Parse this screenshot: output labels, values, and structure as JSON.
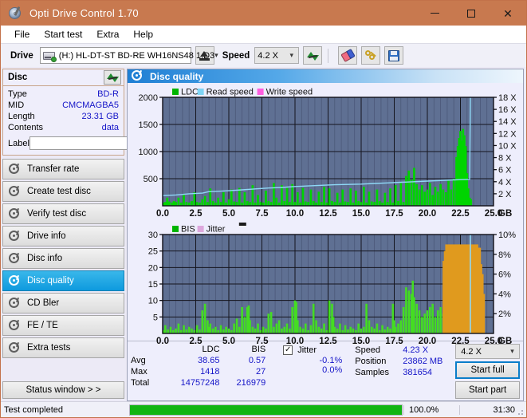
{
  "window": {
    "title": "Opti Drive Control 1.70",
    "title_icon": "disc-pen-icon",
    "minimize": "—",
    "maximize": "□",
    "close": "✕",
    "accent": "#c8794f"
  },
  "menu": {
    "items": [
      "File",
      "Start test",
      "Extra",
      "Help"
    ]
  },
  "toolbar": {
    "drive_label": "Drive",
    "drive_value": "(H:)  HL-DT-ST BD-RE  WH16NS48 1.D3",
    "eject_icon": "eject-icon",
    "speed_label": "Speed",
    "speed_value": "4.2 X",
    "refresh_icon": "refresh-icon",
    "erase_icon": "eraser-icon",
    "keys_icon": "keys-icon",
    "save_icon": "save-icon",
    "dropdown_arrow": "⌄"
  },
  "disc": {
    "header": "Disc",
    "refresh_icon": "refresh-icon",
    "rows": [
      {
        "key": "Type",
        "value": "BD-R"
      },
      {
        "key": "MID",
        "value": "CMCMAGBA5"
      },
      {
        "key": "Length",
        "value": "23.31 GB"
      },
      {
        "key": "Contents",
        "value": "data"
      }
    ],
    "label_key": "Label",
    "label_value": "",
    "label_placeholder": "",
    "cd_icon": "cd-icon"
  },
  "sidebar": {
    "items": [
      {
        "label": "Transfer rate",
        "active": false
      },
      {
        "label": "Create test disc",
        "active": false
      },
      {
        "label": "Verify test disc",
        "active": false
      },
      {
        "label": "Drive info",
        "active": false
      },
      {
        "label": "Disc info",
        "active": false
      },
      {
        "label": "Disc quality",
        "active": true
      },
      {
        "label": "CD Bler",
        "active": false
      },
      {
        "label": "FE / TE",
        "active": false
      },
      {
        "label": "Extra tests",
        "active": false
      }
    ],
    "status_button": "Status window > >"
  },
  "panel": {
    "title": "Disc quality",
    "icon": "disc-quality-icon"
  },
  "stats": {
    "col_headers": [
      "LDC",
      "BIS"
    ],
    "row_labels": [
      "Avg",
      "Max",
      "Total"
    ],
    "ldc": [
      "38.65",
      "1418",
      "14757248"
    ],
    "bis": [
      "0.57",
      "27",
      "216979"
    ],
    "jitter_label": "Jitter",
    "jitter_checked": "✓",
    "jitter_values": [
      "-0.1%",
      "0.0%"
    ],
    "speed_key": "Speed",
    "speed_value": "4.23 X",
    "position_key": "Position",
    "position_value": "23862 MB",
    "samples_key": "Samples",
    "samples_value": "381654",
    "speed_select": "4.2 X",
    "start_full": "Start full",
    "start_part": "Start part"
  },
  "statusbar": {
    "text": "Test completed",
    "progress": 100,
    "percent": "100.0%",
    "time": "31:30",
    "progress_color": "#12b512"
  },
  "chart_data": [
    {
      "id": "ldc-chart",
      "type": "area",
      "title": "Disc quality",
      "xlabel": "GB",
      "ylabel": "LDC",
      "xlim": [
        0,
        25
      ],
      "ylim": [
        0,
        2000
      ],
      "y2lim": [
        0,
        18
      ],
      "y2label": "X",
      "grid": true,
      "legend_position": "top-left",
      "legend": [
        {
          "name": "LDC",
          "color": "#00b400"
        },
        {
          "name": "Read speed",
          "color": "#7fd4f5"
        },
        {
          "name": "Write speed",
          "color": "#ff5ee0"
        }
      ],
      "xticks": [
        0.0,
        2.5,
        5.0,
        7.5,
        10.0,
        12.5,
        15.0,
        17.5,
        20.0,
        22.5,
        25.0
      ],
      "xticklabels": [
        "0.0",
        "2.5",
        "5.0",
        "7.5",
        "10.0",
        "12.5",
        "15.0",
        "17.5",
        "20.0",
        "22.5",
        "25.0"
      ],
      "yticks": [
        500,
        1000,
        1500,
        2000
      ],
      "yticklabels": [
        "500",
        "1000",
        "1500",
        "2000"
      ],
      "y2ticks": [
        2,
        4,
        6,
        8,
        10,
        12,
        14,
        16,
        18
      ],
      "y2ticklabels": [
        "2 X",
        "4 X",
        "6 X",
        "8 X",
        "10 X",
        "12 X",
        "14 X",
        "16 X",
        "18 X"
      ],
      "series": [
        {
          "name": "LDC",
          "color": "#00d400",
          "axis": "left",
          "x": [
            0.05,
            0.2,
            0.35,
            0.5,
            0.7,
            0.85,
            1.0,
            1.2,
            1.4,
            1.6,
            1.8,
            2.0,
            2.2,
            2.4,
            2.6,
            2.8,
            3.0,
            3.2,
            3.4,
            3.6,
            3.8,
            4.0,
            4.2,
            4.4,
            4.6,
            4.8,
            5.0,
            5.2,
            5.4,
            5.6,
            5.8,
            6.0,
            6.2,
            6.4,
            6.6,
            6.8,
            7.0,
            7.2,
            7.4,
            7.6,
            7.8,
            8.0,
            8.2,
            8.4,
            8.6,
            8.8,
            9.0,
            9.2,
            9.4,
            9.6,
            9.8,
            10.0,
            10.2,
            10.4,
            10.6,
            10.8,
            11.0,
            11.2,
            11.4,
            11.6,
            11.8,
            12.0,
            12.2,
            12.4,
            12.6,
            12.8,
            13.0,
            13.2,
            13.4,
            13.6,
            13.8,
            14.0,
            14.2,
            14.4,
            14.6,
            14.8,
            15.0,
            15.2,
            15.4,
            15.6,
            15.8,
            16.0,
            16.2,
            16.4,
            16.6,
            16.8,
            17.0,
            17.2,
            17.4,
            17.6,
            17.8,
            18.0,
            18.2,
            18.4,
            18.6,
            18.8,
            19.0,
            19.2,
            19.4,
            19.6,
            19.8,
            20.0,
            20.2,
            20.4,
            20.6,
            20.8,
            21.0,
            21.2,
            21.4,
            21.6,
            21.8,
            22.0,
            22.2,
            22.3,
            22.4,
            22.5,
            22.6,
            22.7,
            22.8,
            22.9,
            23.0,
            23.1,
            23.2,
            23.3
          ],
          "y": [
            60,
            70,
            150,
            80,
            60,
            90,
            70,
            150,
            60,
            200,
            70,
            60,
            90,
            250,
            70,
            60,
            120,
            180,
            70,
            320,
            90,
            60,
            150,
            70,
            250,
            60,
            120,
            300,
            80,
            70,
            330,
            60,
            250,
            90,
            70,
            380,
            60,
            200,
            70,
            60,
            280,
            90,
            70,
            420,
            150,
            60,
            380,
            90,
            330,
            70,
            400,
            70,
            250,
            60,
            330,
            80,
            70,
            300,
            90,
            60,
            260,
            70,
            350,
            60,
            320,
            90,
            70,
            240,
            60,
            300,
            80,
            70,
            320,
            60,
            280,
            90,
            70,
            350,
            60,
            260,
            80,
            70,
            300,
            90,
            60,
            240,
            70,
            320,
            60,
            380,
            90,
            420,
            70,
            550,
            650,
            480,
            700,
            400,
            300,
            380,
            260,
            300,
            420,
            200,
            350,
            260,
            400,
            300,
            250,
            480,
            300,
            500,
            900,
            1100,
            1250,
            1380,
            1200,
            1418,
            1300,
            1100,
            600,
            320,
            150,
            120
          ]
        },
        {
          "name": "Read speed",
          "color": "#8fd9f7",
          "axis": "right",
          "x": [
            0.0,
            1.0,
            2.0,
            3.0,
            3.5,
            4.0,
            5.0,
            6.0,
            7.0,
            8.0,
            9.0,
            10.0,
            11.0,
            12.0,
            13.0,
            14.0,
            15.0,
            16.0,
            17.0,
            18.0,
            19.0,
            20.0,
            21.0,
            22.0,
            22.8,
            23.2,
            23.25,
            23.3
          ],
          "y": [
            1.7,
            1.8,
            2.0,
            2.1,
            2.35,
            2.4,
            2.5,
            2.65,
            2.8,
            2.95,
            3.05,
            3.2,
            3.3,
            3.4,
            3.5,
            3.55,
            3.6,
            3.7,
            3.8,
            3.9,
            4.0,
            4.1,
            4.2,
            4.3,
            4.35,
            4.4,
            18.0,
            18.0
          ]
        }
      ]
    },
    {
      "id": "bis-chart",
      "type": "area",
      "xlabel": "GB",
      "ylabel": "BIS",
      "xlim": [
        0,
        25
      ],
      "ylim": [
        0,
        30
      ],
      "y2lim": [
        0,
        10
      ],
      "y2label": "%",
      "grid": true,
      "legend_position": "top-left",
      "legend": [
        {
          "name": "BIS",
          "color": "#00b400"
        },
        {
          "name": "Jitter",
          "color": "#dda8dd"
        }
      ],
      "xticks": [
        0.0,
        2.5,
        5.0,
        7.5,
        10.0,
        12.5,
        15.0,
        17.5,
        20.0,
        22.5,
        25.0
      ],
      "xticklabels": [
        "0.0",
        "2.5",
        "5.0",
        "7.5",
        "10.0",
        "12.5",
        "15.0",
        "17.5",
        "20.0",
        "22.5",
        "25.0"
      ],
      "yticks": [
        5,
        10,
        15,
        20,
        25,
        30
      ],
      "yticklabels": [
        "5",
        "10",
        "15",
        "20",
        "25",
        "30"
      ],
      "y2ticks": [
        2,
        4,
        6,
        8,
        10
      ],
      "y2ticklabels": [
        "2%",
        "4%",
        "6%",
        "8%",
        "10%"
      ],
      "series": [
        {
          "name": "BIS",
          "color": "#44dd22",
          "axis": "left",
          "x": [
            0.05,
            0.2,
            0.4,
            0.6,
            0.8,
            1.0,
            1.2,
            1.4,
            1.6,
            1.8,
            2.0,
            2.2,
            2.4,
            2.6,
            2.8,
            3.0,
            3.2,
            3.4,
            3.5,
            3.6,
            3.8,
            4.0,
            4.2,
            4.4,
            4.6,
            4.8,
            5.0,
            5.2,
            5.4,
            5.6,
            5.8,
            6.0,
            6.2,
            6.4,
            6.5,
            6.6,
            6.8,
            7.0,
            7.2,
            7.4,
            7.6,
            7.8,
            8.0,
            8.2,
            8.4,
            8.6,
            8.8,
            9.0,
            9.2,
            9.4,
            9.6,
            9.8,
            10.0,
            10.1,
            10.2,
            10.4,
            10.6,
            10.8,
            11.0,
            11.2,
            11.4,
            11.6,
            11.8,
            12.0,
            12.2,
            12.4,
            12.6,
            12.8,
            12.9,
            13.0,
            13.2,
            13.4,
            13.6,
            13.8,
            14.0,
            14.2,
            14.4,
            14.6,
            14.8,
            15.0,
            15.2,
            15.4,
            15.6,
            15.8,
            16.0,
            16.2,
            16.4,
            16.6,
            16.8,
            17.0,
            17.2,
            17.4,
            17.5,
            17.6,
            17.8,
            18.0,
            18.2,
            18.4,
            18.6,
            18.8,
            18.9,
            19.0,
            19.2,
            19.4,
            19.6,
            19.8,
            20.0,
            20.2,
            20.4,
            20.6,
            20.8,
            21.0,
            21.2,
            21.4,
            21.6,
            21.8,
            22.0,
            22.2,
            22.4,
            22.5,
            22.6,
            22.7,
            22.8,
            22.9,
            23.0,
            23.1,
            23.2,
            23.3
          ],
          "y": [
            1,
            2.5,
            1.2,
            2,
            1,
            1.5,
            3,
            1,
            2.5,
            1.2,
            2,
            1.5,
            1,
            2.5,
            1.2,
            7,
            9,
            4,
            2,
            3,
            1.5,
            2,
            1,
            2.5,
            1.2,
            2,
            1.5,
            1,
            3,
            4.5,
            2,
            8,
            5,
            8,
            8.5,
            4,
            2,
            1.5,
            3,
            1,
            2,
            1.5,
            6,
            6.5,
            2,
            3,
            4,
            1.5,
            2,
            3,
            1.5,
            8,
            10,
            9.5,
            4,
            2,
            1.5,
            3,
            1,
            2.5,
            9,
            4,
            2,
            1.5,
            3,
            1,
            10,
            9,
            5,
            2,
            1.5,
            3,
            1,
            2.5,
            1.2,
            2,
            1.5,
            1,
            3,
            1.5,
            2,
            9,
            4,
            2,
            1.5,
            3,
            1,
            2.5,
            1.2,
            2,
            1.5,
            9,
            4,
            2,
            3,
            4,
            8,
            14,
            13,
            12,
            16,
            11,
            9,
            7,
            5,
            6,
            7,
            8,
            9,
            5,
            7,
            8,
            6,
            9,
            8,
            7,
            6,
            26,
            27,
            22,
            24,
            20,
            18,
            16,
            14,
            5,
            3
          ]
        },
        {
          "name": "Jitter",
          "color": "#e09a1e",
          "axis": "left",
          "x": [
            22.4,
            22.5,
            22.6,
            22.7,
            22.8,
            22.9,
            23.0,
            23.1
          ],
          "y": [
            22,
            25,
            27,
            24,
            26,
            21,
            18,
            12
          ]
        },
        {
          "name": "Read speed marker",
          "color": "#8fd9f7",
          "axis": "left",
          "x": [
            23.25,
            23.25
          ],
          "y": [
            0,
            30
          ]
        }
      ]
    }
  ]
}
